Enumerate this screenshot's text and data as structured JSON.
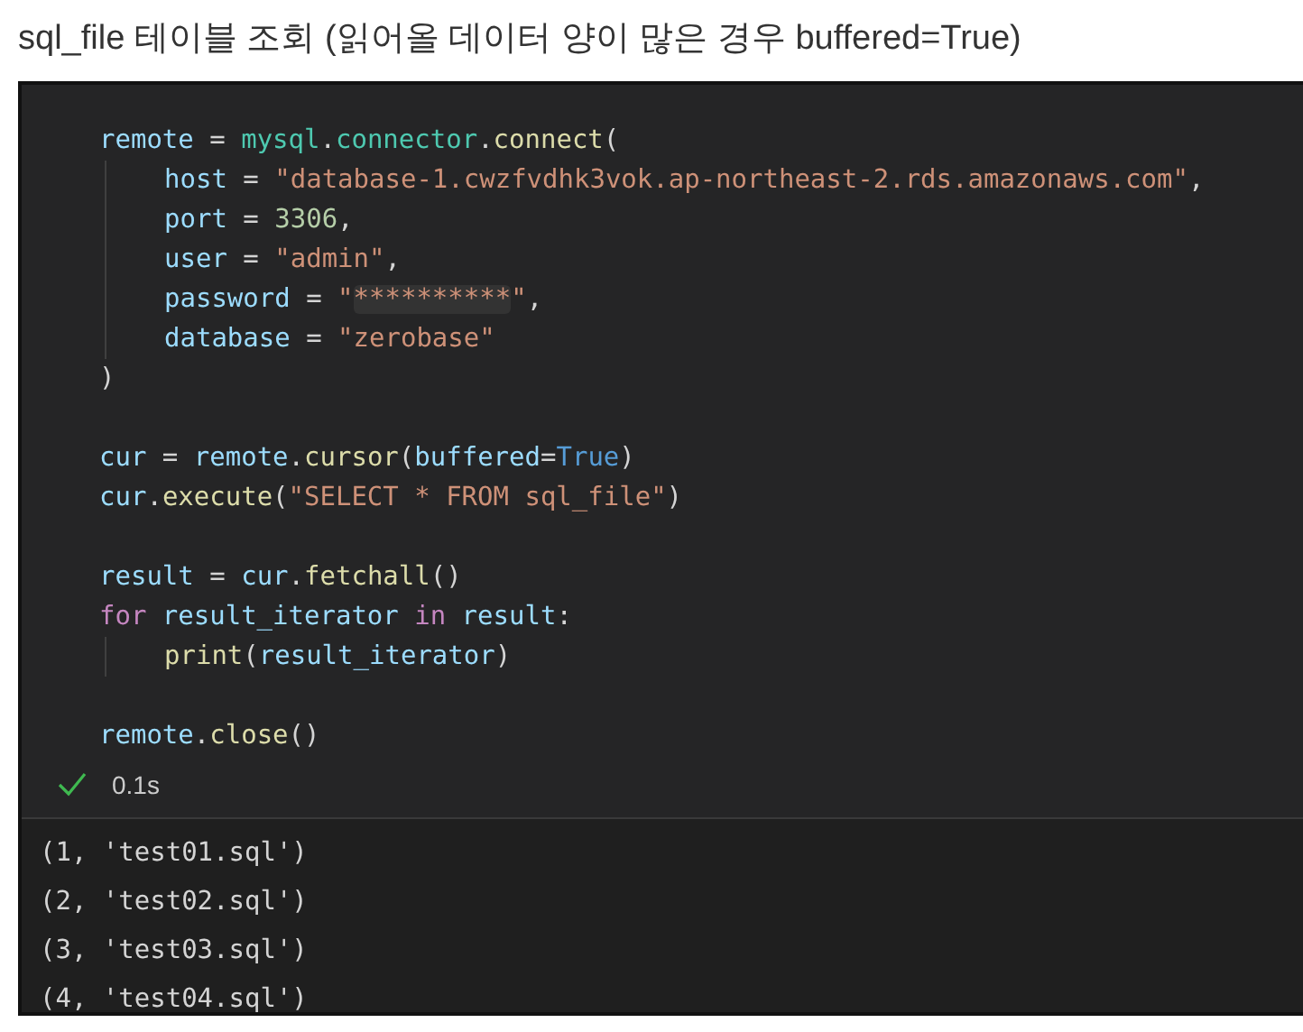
{
  "heading": "sql_file 테이블 조회 (읽어올 데이터 양이 많은 경우 buffered=True)",
  "code_cell": {
    "lines": [
      {
        "kind": "code",
        "tokens": [
          {
            "kind": "var",
            "text": "remote"
          },
          {
            "kind": "plain",
            "text": " = "
          },
          {
            "kind": "module",
            "text": "mysql"
          },
          {
            "kind": "plain",
            "text": "."
          },
          {
            "kind": "module",
            "text": "connector"
          },
          {
            "kind": "plain",
            "text": "."
          },
          {
            "kind": "fn",
            "text": "connect"
          },
          {
            "kind": "plain",
            "text": "("
          }
        ],
        "children": [
          {
            "kind": "code",
            "tokens": [
              {
                "kind": "var",
                "text": "host"
              },
              {
                "kind": "plain",
                "text": " = "
              },
              {
                "kind": "str",
                "text": "\"database-1.cwzfvdhk3vok.ap-northeast-2.rds.amazonaws.com\""
              },
              {
                "kind": "plain",
                "text": ","
              }
            ]
          },
          {
            "kind": "code",
            "tokens": [
              {
                "kind": "var",
                "text": "port"
              },
              {
                "kind": "plain",
                "text": " = "
              },
              {
                "kind": "num",
                "text": "3306"
              },
              {
                "kind": "plain",
                "text": ","
              }
            ]
          },
          {
            "kind": "code",
            "tokens": [
              {
                "kind": "var",
                "text": "user"
              },
              {
                "kind": "plain",
                "text": " = "
              },
              {
                "kind": "str",
                "text": "\"admin\""
              },
              {
                "kind": "plain",
                "text": ","
              }
            ]
          },
          {
            "kind": "code",
            "tokens": [
              {
                "kind": "var",
                "text": "password"
              },
              {
                "kind": "plain",
                "text": " = "
              },
              {
                "kind": "str",
                "text": "\""
              },
              {
                "kind": "masked",
                "text": "**********"
              },
              {
                "kind": "str",
                "text": "\""
              },
              {
                "kind": "plain",
                "text": ","
              }
            ]
          },
          {
            "kind": "code",
            "tokens": [
              {
                "kind": "var",
                "text": "database"
              },
              {
                "kind": "plain",
                "text": " = "
              },
              {
                "kind": "str",
                "text": "\"zerobase\""
              }
            ]
          }
        ]
      },
      {
        "kind": "code",
        "tokens": [
          {
            "kind": "plain",
            "text": ")"
          }
        ]
      },
      {
        "kind": "blank"
      },
      {
        "kind": "code",
        "tokens": [
          {
            "kind": "var",
            "text": "cur"
          },
          {
            "kind": "plain",
            "text": " = "
          },
          {
            "kind": "var",
            "text": "remote"
          },
          {
            "kind": "plain",
            "text": "."
          },
          {
            "kind": "fn",
            "text": "cursor"
          },
          {
            "kind": "plain",
            "text": "("
          },
          {
            "kind": "var",
            "text": "buffered"
          },
          {
            "kind": "plain",
            "text": "="
          },
          {
            "kind": "const",
            "text": "True"
          },
          {
            "kind": "plain",
            "text": ")"
          }
        ]
      },
      {
        "kind": "code",
        "tokens": [
          {
            "kind": "var",
            "text": "cur"
          },
          {
            "kind": "plain",
            "text": "."
          },
          {
            "kind": "fn",
            "text": "execute"
          },
          {
            "kind": "plain",
            "text": "("
          },
          {
            "kind": "str",
            "text": "\"SELECT * FROM sql_file\""
          },
          {
            "kind": "plain",
            "text": ")"
          }
        ]
      },
      {
        "kind": "blank"
      },
      {
        "kind": "code",
        "tokens": [
          {
            "kind": "var",
            "text": "result"
          },
          {
            "kind": "plain",
            "text": " = "
          },
          {
            "kind": "var",
            "text": "cur"
          },
          {
            "kind": "plain",
            "text": "."
          },
          {
            "kind": "fn",
            "text": "fetchall"
          },
          {
            "kind": "plain",
            "text": "()"
          }
        ]
      },
      {
        "kind": "code",
        "tokens": [
          {
            "kind": "kw",
            "text": "for"
          },
          {
            "kind": "var",
            "text": " result_iterator "
          },
          {
            "kind": "kw",
            "text": "in"
          },
          {
            "kind": "var",
            "text": " result"
          },
          {
            "kind": "plain",
            "text": ":"
          }
        ],
        "children": [
          {
            "kind": "code",
            "tokens": [
              {
                "kind": "fn",
                "text": "print"
              },
              {
                "kind": "plain",
                "text": "("
              },
              {
                "kind": "var",
                "text": "result_iterator"
              },
              {
                "kind": "plain",
                "text": ")"
              }
            ]
          }
        ]
      },
      {
        "kind": "blank"
      },
      {
        "kind": "code",
        "tokens": [
          {
            "kind": "var",
            "text": "remote"
          },
          {
            "kind": "plain",
            "text": "."
          },
          {
            "kind": "fn",
            "text": "close"
          },
          {
            "kind": "plain",
            "text": "()"
          }
        ]
      }
    ],
    "status": {
      "success": true,
      "duration": "0.1s"
    },
    "output": [
      "(1, 'test01.sql')",
      "(2, 'test02.sql')",
      "(3, 'test03.sql')",
      "(4, 'test04.sql')"
    ]
  }
}
